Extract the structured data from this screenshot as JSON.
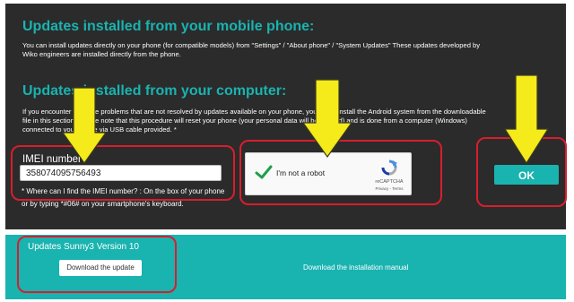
{
  "mobile_section": {
    "heading": "Updates installed from your mobile phone:",
    "text_line1": "You can install updates directly on your phone (for compatible models) from \"Settings\" / \"About phone\" / \"System Updates\" These updates developed by",
    "text_line2": "Wiko engineers are installed directly from the phone."
  },
  "computer_section": {
    "heading": "Updates installed from your computer:",
    "text_line1": "If you encounter software problems that are not resolved by updates available on your phone, you can reinstall the Android system from the downloadable",
    "text_line2": "file in this section. Please note that this procedure will reset your phone (your personal data will be deleted) and is done from a computer (Windows)",
    "text_line3": "connected to your phone via USB cable provided. *"
  },
  "imei": {
    "label": "IMEI number*",
    "value": "358074095756493",
    "help": "* Where can I find the IMEI number? : On the box of your phone or by typing  *#06# on your smartphone's keyboard."
  },
  "captcha": {
    "label": "I'm not a robot",
    "brand": "reCAPTCHA",
    "terms": "Privacy - Terms",
    "checked": true
  },
  "ok_button": {
    "label": "OK"
  },
  "update_panel": {
    "title": "Updates Sunny3 Version 10",
    "download_label": "Download the update",
    "manual_label": "Download the installation manual"
  },
  "colors": {
    "accent": "#19b3b0",
    "dark_panel": "#2b2b2b",
    "highlight_ring": "#d81e2c",
    "arrow": "#f5ea1a"
  }
}
